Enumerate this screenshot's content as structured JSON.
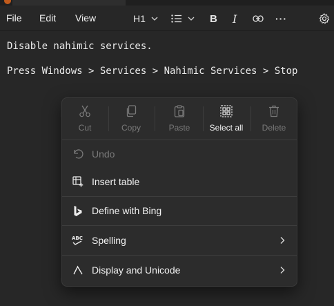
{
  "menubar": {
    "file_label": "File",
    "edit_label": "Edit",
    "view_label": "View"
  },
  "toolbar": {
    "heading_label": "H1",
    "bold_glyph": "B",
    "italic_glyph": "I",
    "more_glyph": "···"
  },
  "editor": {
    "lines": [
      "Disable nahimic services.",
      "Press Windows > Services > Nahimic Services > Stop"
    ]
  },
  "context_menu": {
    "quick_actions": [
      {
        "label": "Cut",
        "icon": "scissors-icon",
        "enabled": false
      },
      {
        "label": "Copy",
        "icon": "copy-icon",
        "enabled": false
      },
      {
        "label": "Paste",
        "icon": "paste-icon",
        "enabled": false
      },
      {
        "label": "Select all",
        "icon": "select-all-icon",
        "enabled": true
      },
      {
        "label": "Delete",
        "icon": "trash-icon",
        "enabled": false
      }
    ],
    "items": [
      {
        "label": "Undo",
        "icon": "undo-icon",
        "enabled": false
      },
      {
        "label": "Insert table",
        "icon": "table-icon",
        "enabled": true
      },
      {
        "label": "Define with Bing",
        "icon": "bing-icon",
        "enabled": true
      },
      {
        "label": "Spelling",
        "icon": "abc-check-icon",
        "enabled": true,
        "submenu": true
      },
      {
        "label": "Display and Unicode",
        "icon": "lambda-icon",
        "enabled": true,
        "submenu": true
      }
    ]
  },
  "colors": {
    "background": "#272727",
    "menu_background": "#2c2c2c",
    "disabled_text": "#7a7a7a",
    "text": "#f2f2f2"
  }
}
